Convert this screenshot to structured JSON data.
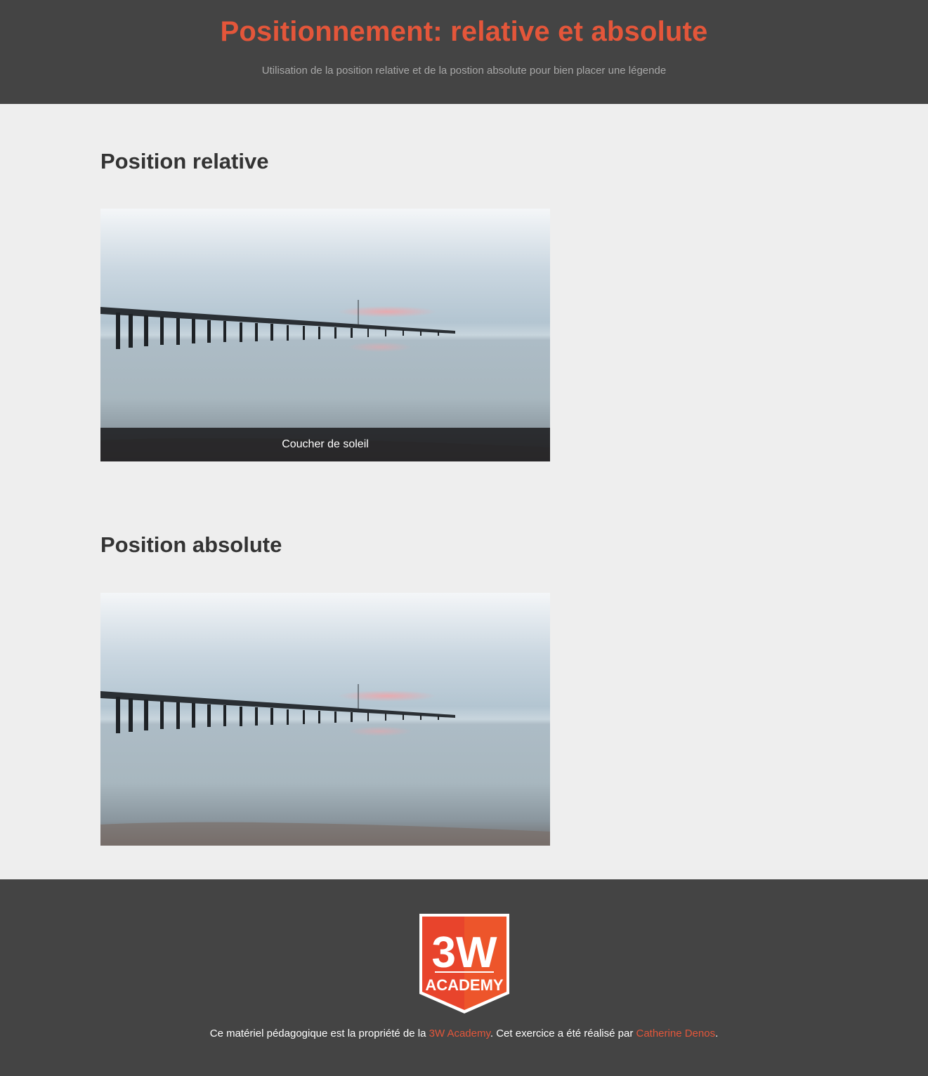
{
  "header": {
    "title": "Positionnement: relative et absolute",
    "subtitle": "Utilisation de la position relative et de la postion absolute pour bien placer une légende"
  },
  "sections": [
    {
      "title": "Position relative",
      "caption": "Coucher de soleil"
    },
    {
      "title": "Position absolute"
    }
  ],
  "footer": {
    "logo_text_top": "3W",
    "logo_text_bottom": "ACADEMY",
    "text_before": "Ce matériel pédagogique est la propriété de la ",
    "link1": "3W Academy",
    "text_middle": ". Cet exercice a été réalisé par ",
    "link2": "Catherine Denos",
    "text_after": "."
  },
  "colors": {
    "accent": "#e4563a",
    "dark": "#444444",
    "background": "#eeeeee"
  }
}
